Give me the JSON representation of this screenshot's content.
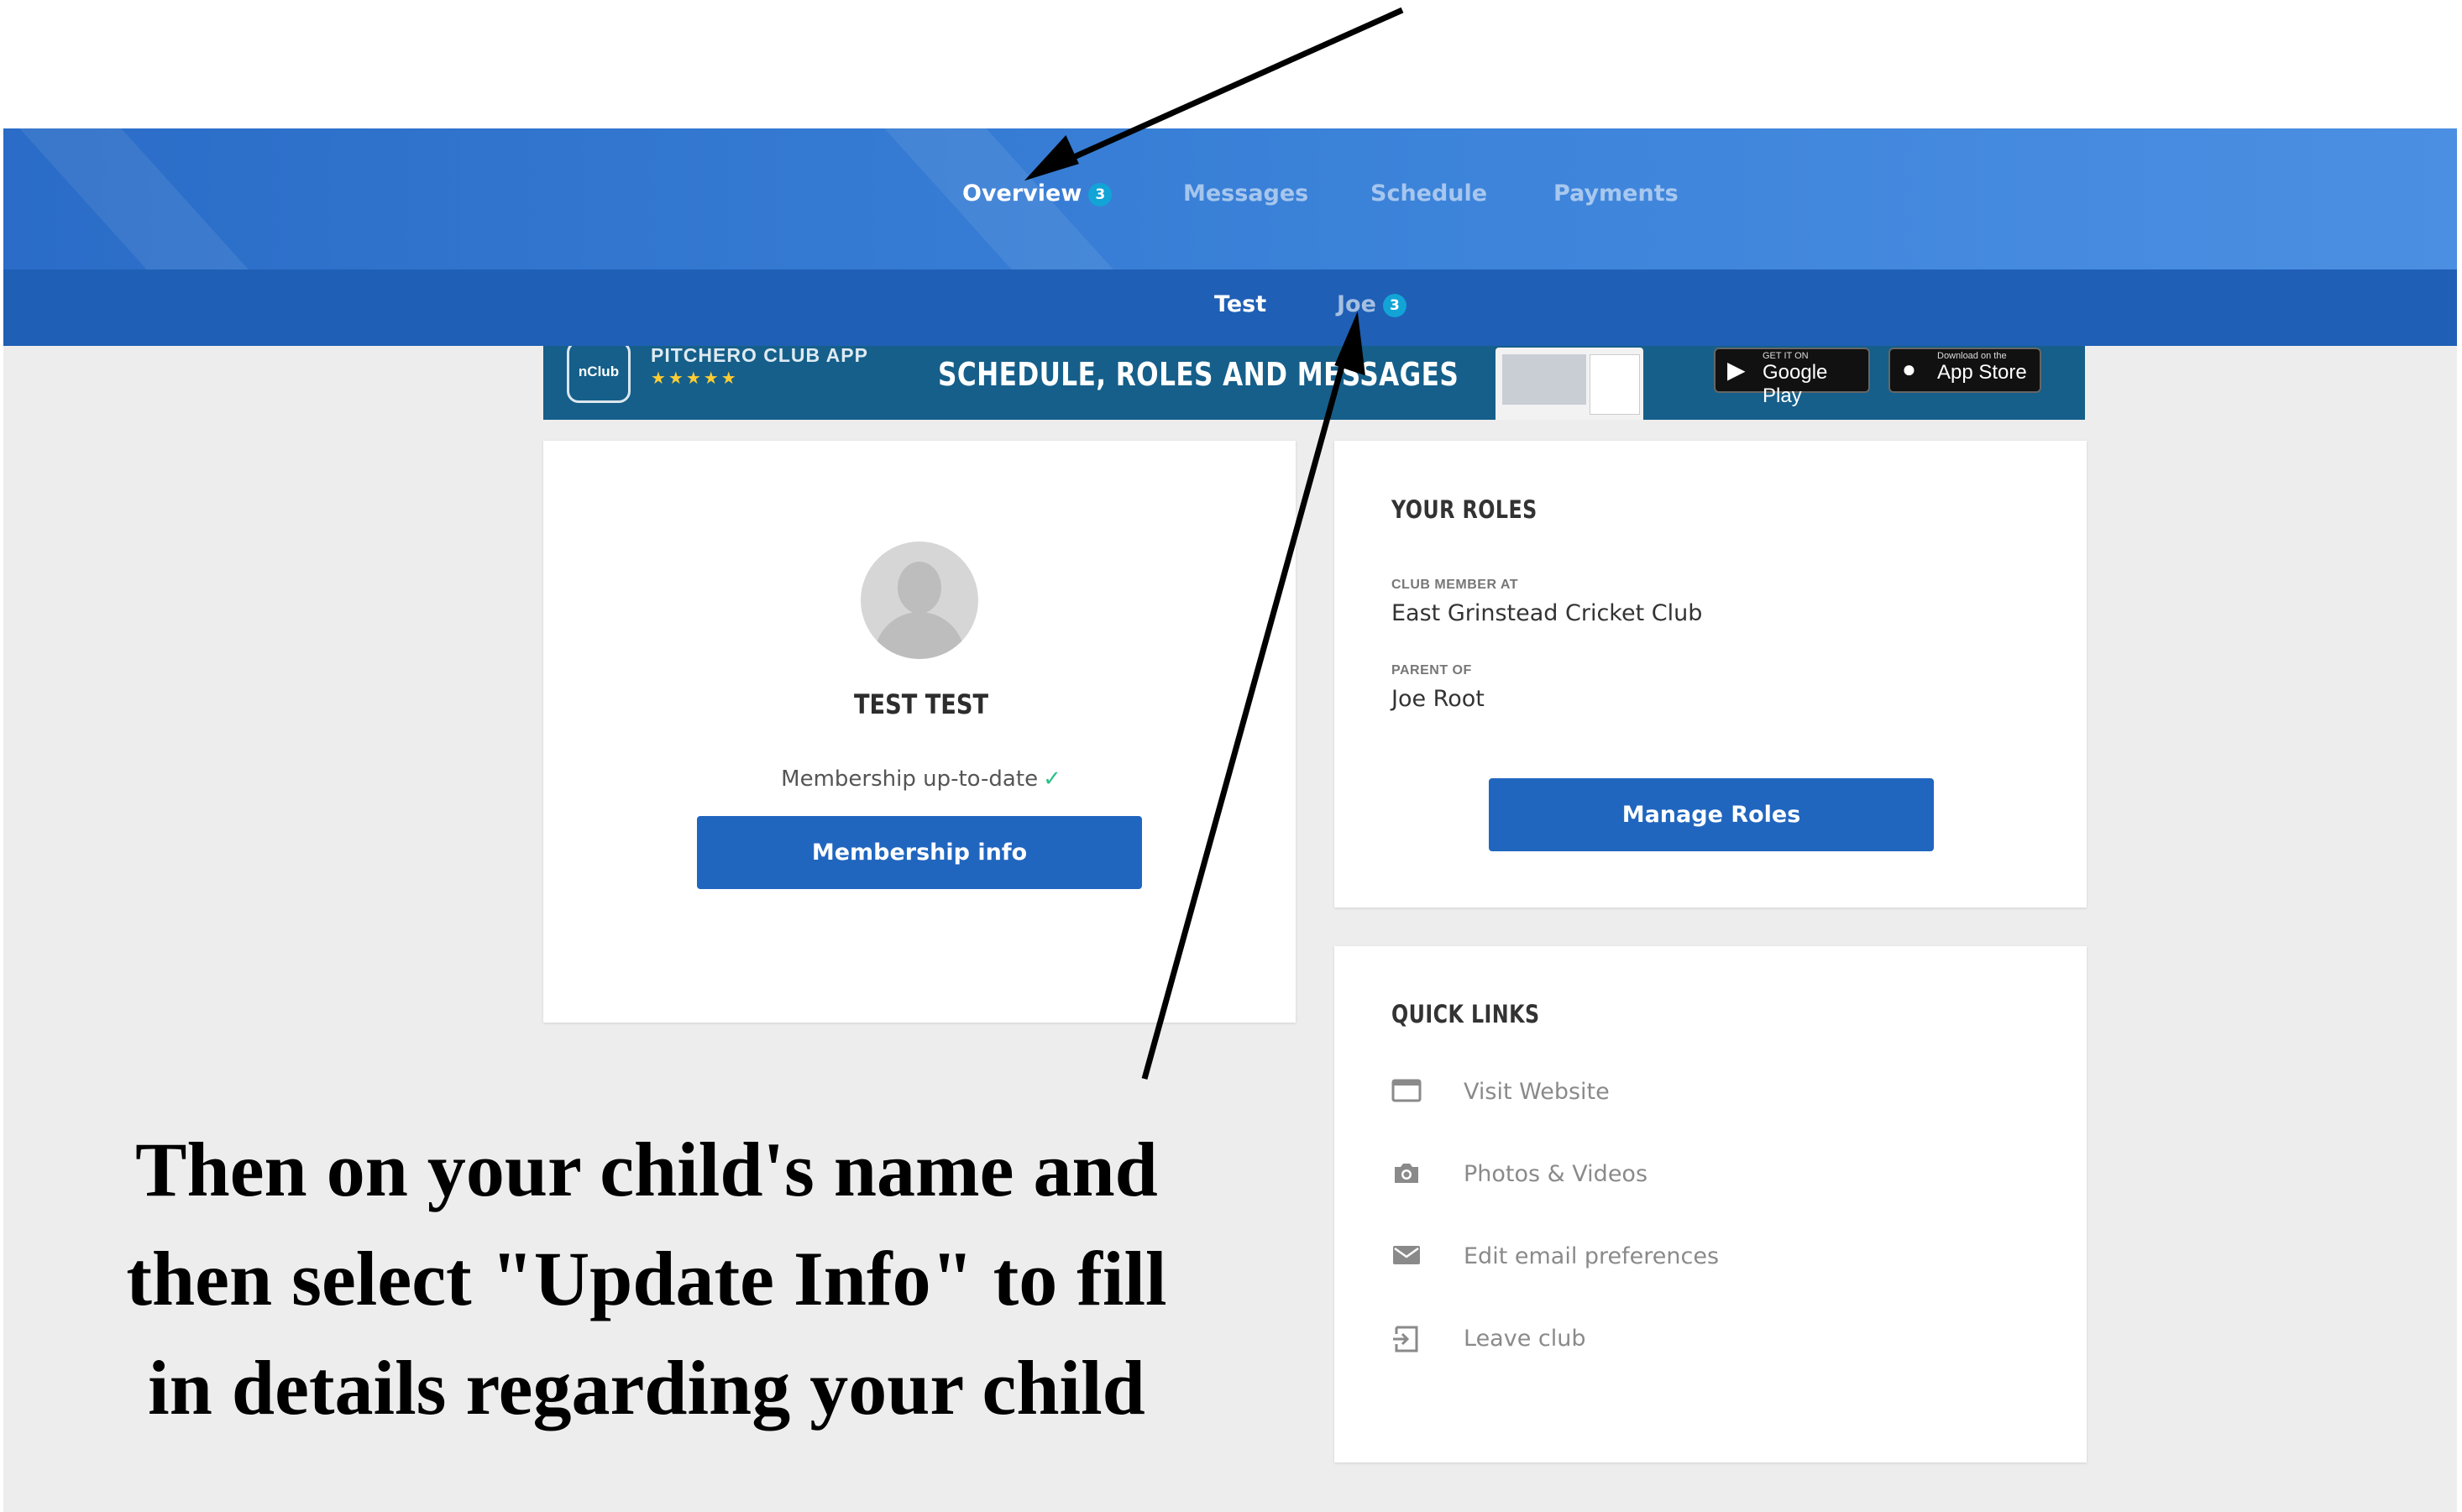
{
  "top_nav": {
    "items": [
      {
        "label": "Overview",
        "badge": "3"
      },
      {
        "label": "Messages"
      },
      {
        "label": "Schedule"
      },
      {
        "label": "Payments"
      }
    ]
  },
  "sub_nav": {
    "items": [
      {
        "label": "Test"
      },
      {
        "label": "Joe",
        "badge": "3"
      }
    ]
  },
  "banner": {
    "logo_text": "nClub",
    "app_name": "PITCHERO CLUB APP",
    "stars": "★★★★★",
    "headline": "SCHEDULE, ROLES AND MESSAGES",
    "google_small": "GET IT ON",
    "google_big": "Google Play",
    "apple_small": "Download on the",
    "apple_big": "App Store"
  },
  "profile": {
    "name": "TEST TEST",
    "membership_status": "Membership up-to-date",
    "check": "✓",
    "membership_button": "Membership info"
  },
  "roles": {
    "title": "YOUR ROLES",
    "club_label": "CLUB MEMBER AT",
    "club_value": "East Grinstead Cricket Club",
    "parent_label": "PARENT OF",
    "parent_value": "Joe Root",
    "manage_button": "Manage Roles"
  },
  "quick_links": {
    "title": "QUICK LINKS",
    "items": [
      {
        "label": "Visit Website",
        "icon": "browser-window-icon"
      },
      {
        "label": "Photos & Videos",
        "icon": "camera-icon"
      },
      {
        "label": "Edit email preferences",
        "icon": "envelope-icon"
      },
      {
        "label": "Leave club",
        "icon": "exit-icon"
      }
    ]
  },
  "annotation": {
    "line1": "Then on your child's name and",
    "line2": "then select \"Update Info\" to fill",
    "line3": "in details regarding your child"
  },
  "colors": {
    "nav_blue": "#3b82d9",
    "subnav_blue": "#1f5fb5",
    "button_blue": "#2066bf",
    "badge_cyan": "#12a4d6",
    "check_green": "#2bbf8a"
  }
}
